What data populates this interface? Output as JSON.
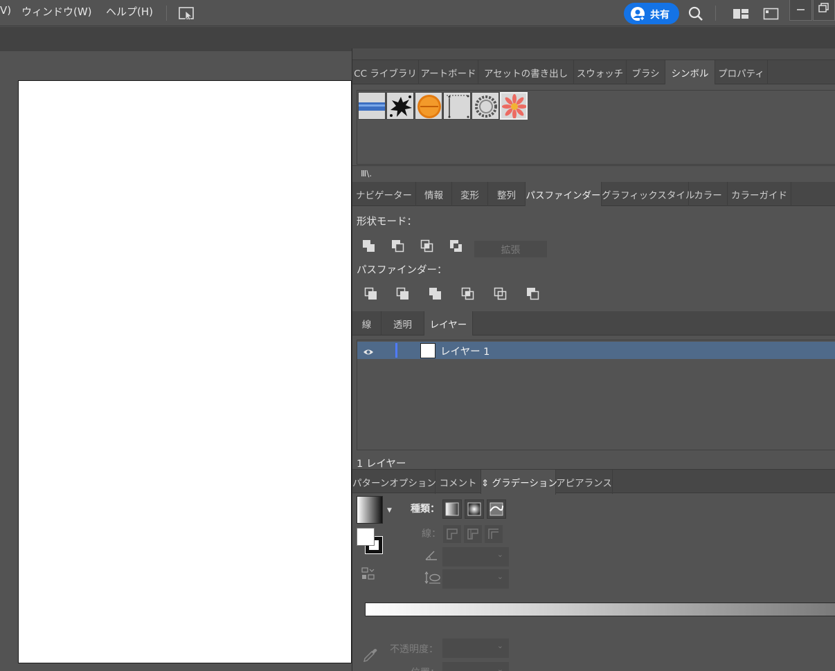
{
  "menubar": {
    "items": [
      "V)",
      "ウィンドウ(W)",
      "ヘルプ(H)"
    ],
    "share_label": "共有"
  },
  "symbols_panel": {
    "tabs": [
      "CC ライブラリ",
      "アートボード",
      "アセットの書き出し",
      "スウォッチ",
      "ブラシ",
      "シンボル",
      "プロパティ"
    ],
    "active_tab": "シンボル",
    "library_icon_label": "Ⅲ\\."
  },
  "pathfinder_panel": {
    "tabs": [
      "ナビゲーター",
      "情報",
      "変形",
      "整列",
      "パスファインダー",
      "グラフィックスタイル",
      "カラー",
      "カラーガイド"
    ],
    "active_tab": "パスファインダー",
    "shape_modes_label": "形状モード：",
    "expand_label": "拡張",
    "pathfinders_label": "パスファインダー："
  },
  "layers_panel": {
    "tabs": [
      "線",
      "透明",
      "レイヤー"
    ],
    "active_tab": "レイヤー",
    "layers": [
      {
        "name": "レイヤー 1"
      }
    ],
    "count_label": "1 レイヤー"
  },
  "gradient_panel": {
    "tabs": [
      "パターンオプション",
      "コメント",
      "⇕ グラデーション",
      "アピアランス"
    ],
    "active_tab": "⇕ グラデーション",
    "type_label": "種類：",
    "stroke_label": "線：",
    "opacity_label": "不透明度：",
    "position_label": "位置："
  },
  "colors": {
    "accent": "#1473e6",
    "layer_selection": "#4f6a8a",
    "layer_color": "#4f7bff"
  }
}
